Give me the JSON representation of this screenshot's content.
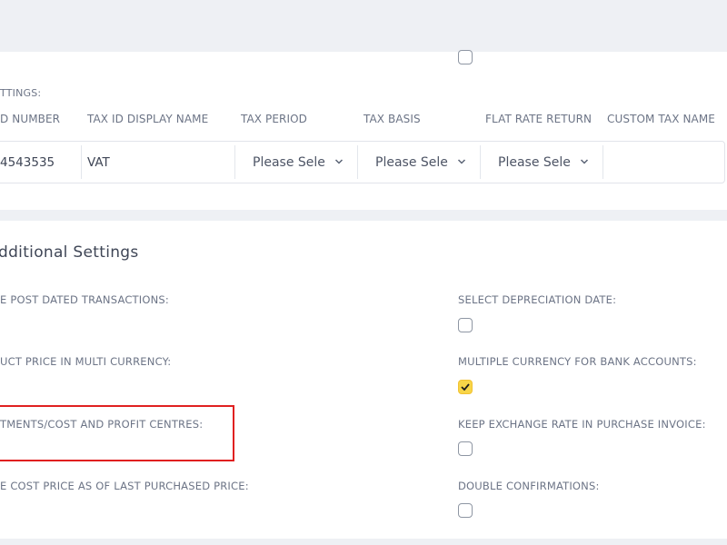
{
  "tax_settings": {
    "section_label": "TTINGS:",
    "columns": [
      "D NUMBER",
      "TAX ID DISPLAY NAME",
      "TAX PERIOD",
      "TAX BASIS",
      "FLAT RATE RETURN",
      "CUSTOM TAX NAME"
    ],
    "row": {
      "tax_number": "4543535",
      "tax_display_name": "VAT",
      "tax_period": "Please Sele",
      "tax_basis": "Please Sele",
      "flat_rate_return": "Please Sele",
      "custom_tax_name": ""
    }
  },
  "additional_settings": {
    "heading": "dditional Settings",
    "left_labels": [
      "E POST DATED TRANSACTIONS:",
      "UCT PRICE IN MULTI CURRENCY:",
      "TMENTS/COST AND PROFIT CENTRES:",
      "E COST PRICE AS OF LAST PURCHASED PRICE:"
    ],
    "right_options": [
      {
        "label": "SELECT DEPRECIATION DATE:",
        "checked": false
      },
      {
        "label": "MULTIPLE CURRENCY FOR BANK ACCOUNTS:",
        "checked": true
      },
      {
        "label": "KEEP EXCHANGE RATE IN PURCHASE INVOICE:",
        "checked": false
      },
      {
        "label": "DOUBLE CONFIRMATIONS:",
        "checked": false
      }
    ]
  },
  "colors": {
    "checkbox_checked": "#f8d548",
    "highlight_box": "#e02020"
  }
}
